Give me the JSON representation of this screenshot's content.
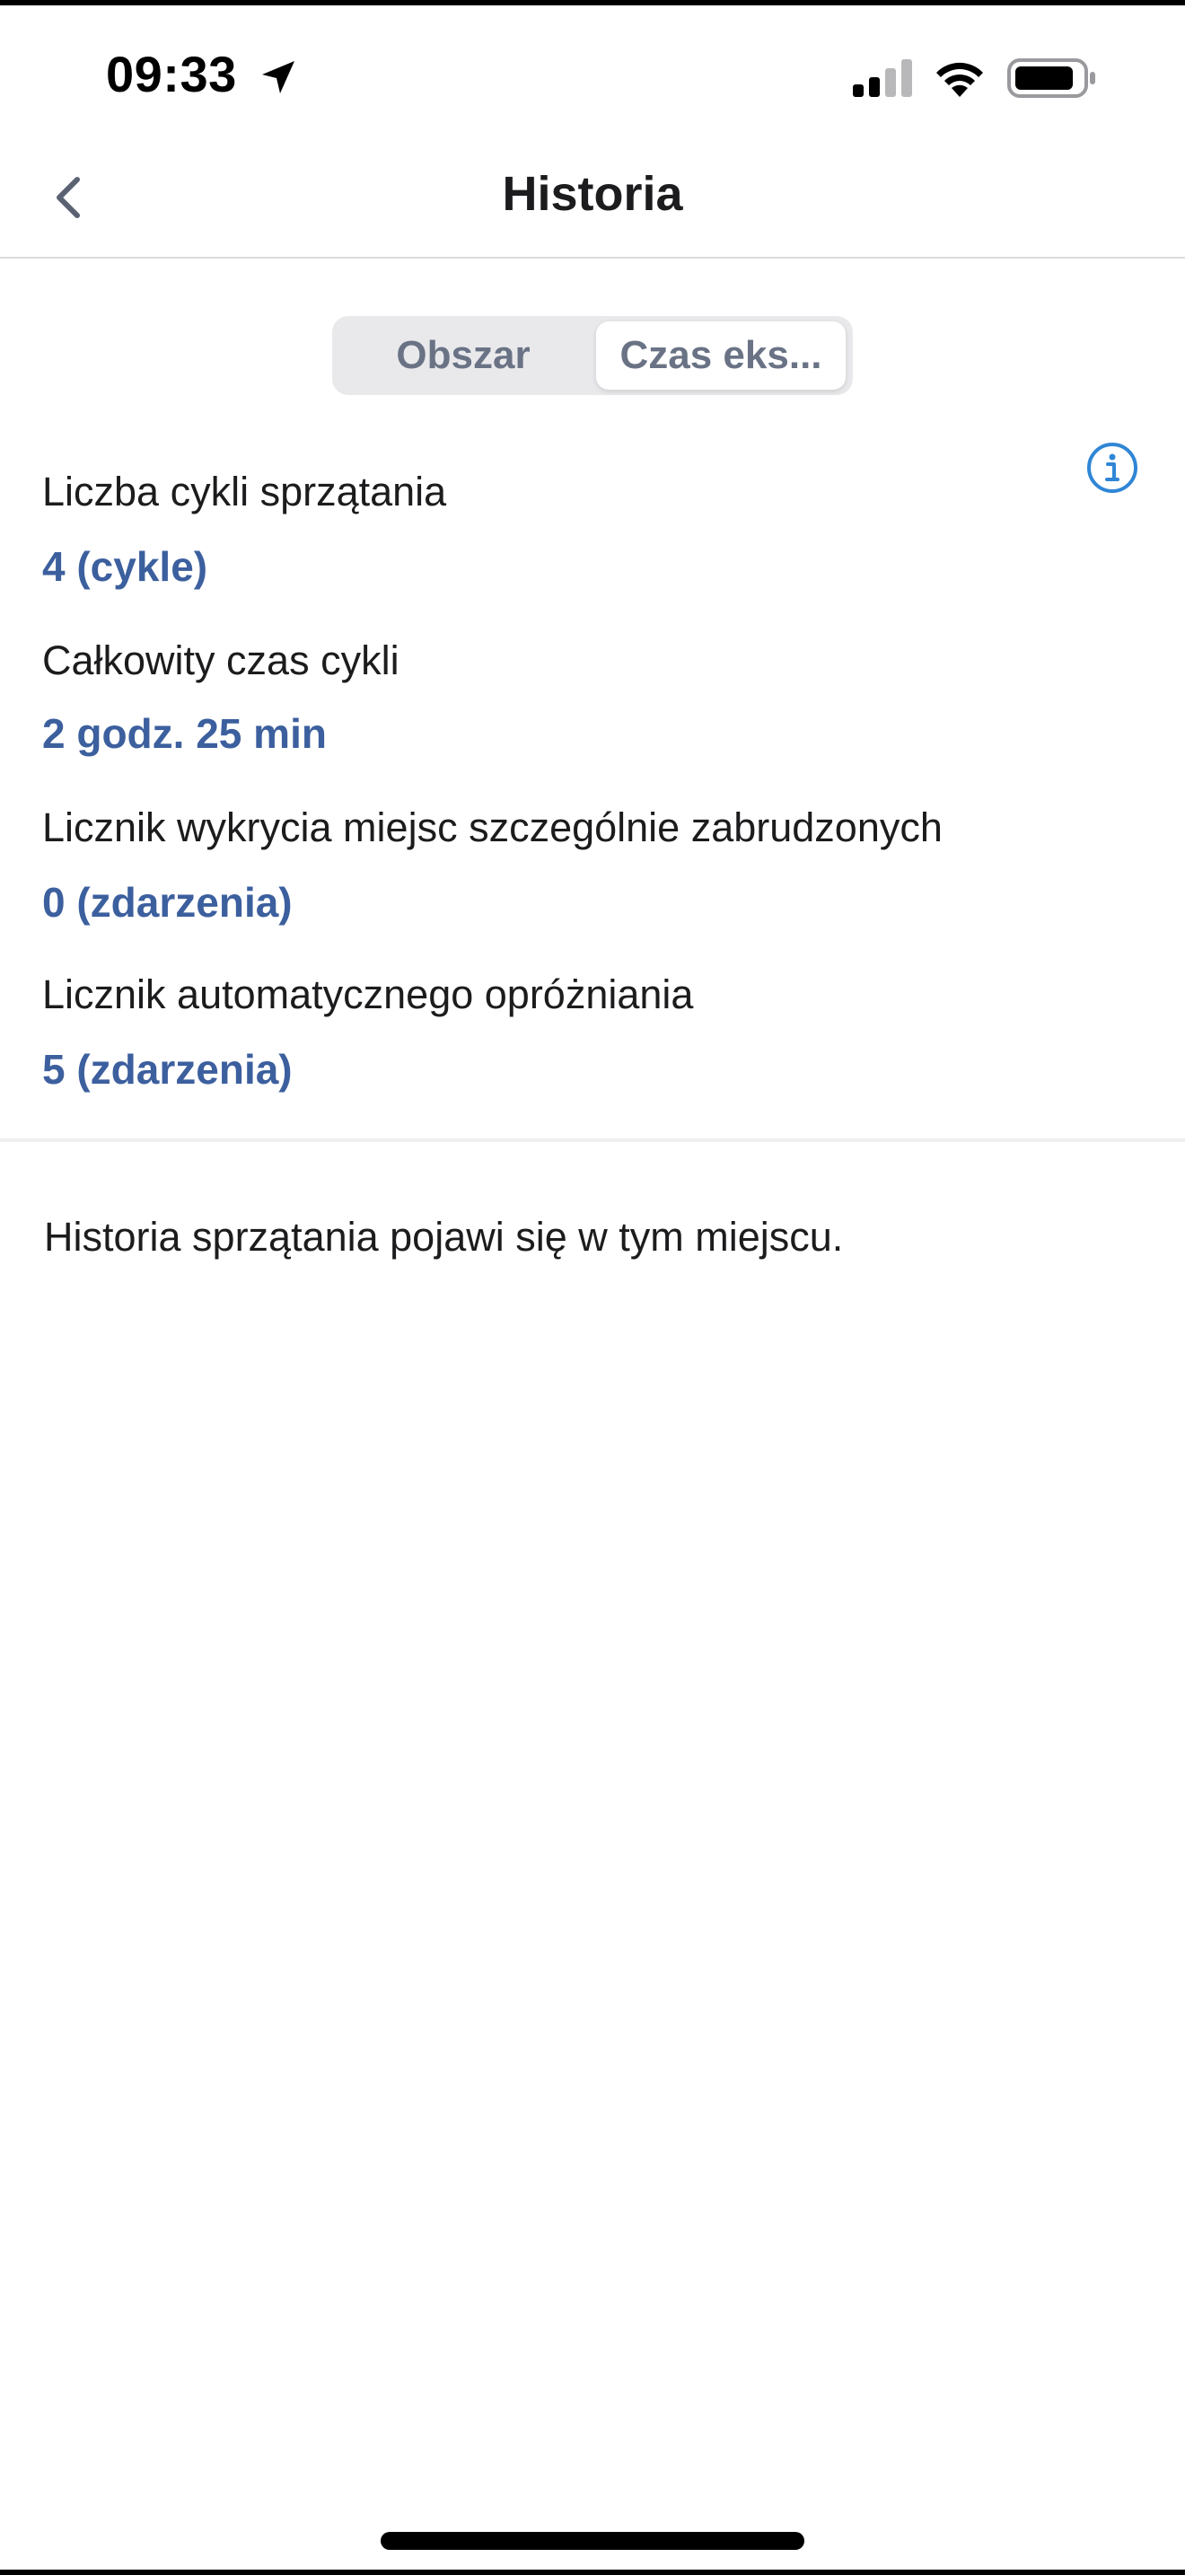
{
  "status_bar": {
    "time": "09:33"
  },
  "nav": {
    "title": "Historia"
  },
  "segmented": {
    "items": [
      "Obszar",
      "Czas eks..."
    ],
    "selected": "Czas eks..."
  },
  "stats": [
    {
      "label": "Liczba cykli sprzątania",
      "value": "4 (cykle)"
    },
    {
      "label": "Całkowity czas cykli",
      "value": "2 godz. 25 min"
    },
    {
      "label": "Licznik wykrycia miejsc szczególnie zabrudzonych",
      "value": "0 (zdarzenia)"
    },
    {
      "label": "Licznik automatycznego opróżniania",
      "value": "5 (zdarzenia)"
    }
  ],
  "history": {
    "empty_message": "Historia sprzątania pojawi się w tym miejscu."
  },
  "colors": {
    "accent_value": "#3c5f9e",
    "info_icon": "#2f86d6",
    "segment_bg": "#e9e9ec"
  },
  "icons": {
    "back": "chevron-left-icon",
    "location": "location-arrow-icon",
    "signal": "cellular-signal-icon",
    "wifi": "wifi-icon",
    "battery": "battery-icon",
    "info": "info-icon"
  }
}
